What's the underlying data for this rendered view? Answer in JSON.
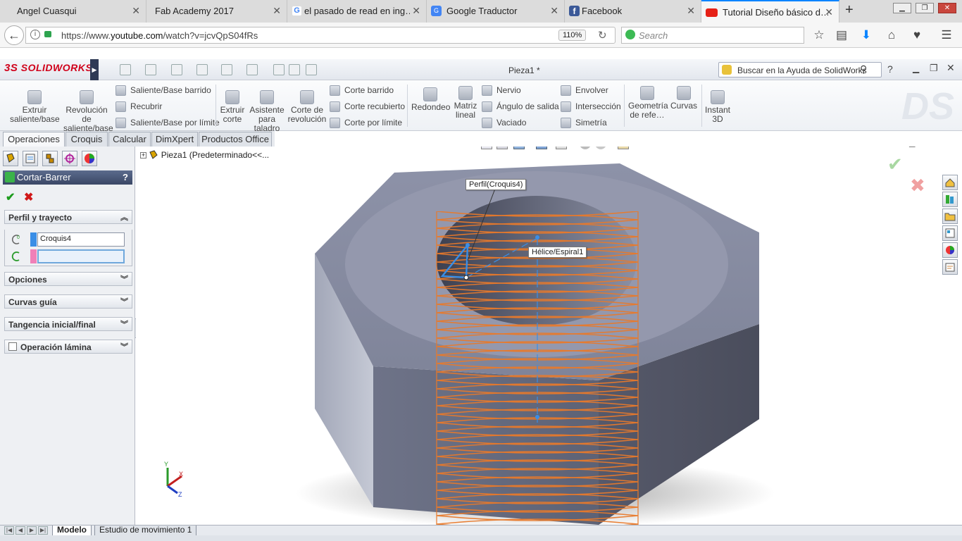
{
  "browser": {
    "tabs": [
      {
        "title": "Angel Cuasqui",
        "favicon": "none"
      },
      {
        "title": "Fab Academy 2017",
        "favicon": "none"
      },
      {
        "title": "el pasado de read en ing…",
        "favicon": "google-icon"
      },
      {
        "title": "Google Traductor",
        "favicon": "translate-icon"
      },
      {
        "title": "Facebook",
        "favicon": "facebook-icon"
      },
      {
        "title": "Tutorial Diseño básico d…",
        "favicon": "youtube-icon"
      }
    ],
    "url_prefix": "https://www.",
    "url_domain": "youtube.com",
    "url_path": "/watch?v=jcvQpS04fRs",
    "zoom": "110%",
    "search_placeholder": "Search"
  },
  "sw": {
    "logo_text": "SOLIDWORKS",
    "logo_mark": "3S",
    "doc_title": "Pieza1 *",
    "help_search_placeholder": "Buscar en la Ayuda de SolidWorks",
    "ribbon": {
      "extrude": "Extruir saliente/base",
      "revolve": "Revolución de saliente/base",
      "sweep_boss": "Saliente/Base barrido",
      "loft": "Recubrir",
      "boundary_boss": "Saliente/Base por límite",
      "extrude_cut": "Extruir corte",
      "hole_wizard": "Asistente para taladro",
      "revolve_cut": "Corte de revolución",
      "sweep_cut": "Corte barrido",
      "loft_cut": "Corte recubierto",
      "boundary_cut": "Corte por límite",
      "fillet": "Redondeo",
      "linear_pattern": "Matriz lineal",
      "rib": "Nervio",
      "draft": "Ángulo de salida",
      "shell": "Vaciado",
      "wrap": "Envolver",
      "intersect": "Intersección",
      "mirror": "Simetría",
      "ref_geometry": "Geometría de refe…",
      "curves": "Curvas",
      "instant3d": "Instant 3D"
    },
    "command_tabs": [
      "Operaciones",
      "Croquis",
      "Calcular",
      "DimXpert",
      "Productos Office"
    ],
    "feature_name": "Cortar-Barrer",
    "help_q": "?",
    "sections": {
      "profile_path": "Perfil y trayecto",
      "profile_value": "Croquis4",
      "path_value": "",
      "options": "Opciones",
      "guide_curves": "Curvas guía",
      "tangency": "Tangencia inicial/final",
      "thin": "Operación lámina"
    },
    "tree_root": "Pieza1  (Predeterminado<<...",
    "callouts": {
      "profile": "Perfil(Croquis4)",
      "helix": "Hélice/Espiral1"
    },
    "triad": {
      "x": "X",
      "y": "Y",
      "z": "Z"
    },
    "bottom_tabs": [
      "Modelo",
      "Estudio de movimiento 1"
    ]
  },
  "colors": {
    "accent_blue": "#0a84ff",
    "solidworks_red": "#d0021b",
    "helix_orange": "#e8792a",
    "sketch_blue": "#3a8ee6",
    "nut_grey": "#8e93a8"
  }
}
